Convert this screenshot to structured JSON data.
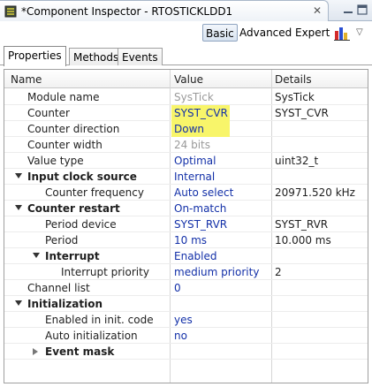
{
  "window": {
    "title": "*Component Inspector - RTOSTICKLDD1",
    "close_glyph": "✕"
  },
  "toolbar": {
    "modes": [
      "Basic",
      "Advanced",
      "Expert"
    ],
    "selected_mode": "Basic",
    "chart_icon": "bar-chart-icon",
    "menu_glyph": "▽"
  },
  "tabs": [
    {
      "label": "Properties",
      "active": true
    },
    {
      "label": "Methods",
      "active": false
    },
    {
      "label": "Events",
      "active": false
    }
  ],
  "table": {
    "headers": {
      "name": "Name",
      "value": "Value",
      "details": "Details"
    },
    "rows": [
      {
        "name": "Module name",
        "value": "SysTick",
        "details": "SysTick",
        "value_gray": true
      },
      {
        "name": "Counter",
        "value": "SYST_CVR",
        "details": "SYST_CVR",
        "highlight": true
      },
      {
        "name": "Counter direction",
        "value": "Down",
        "details": "",
        "highlight": true
      },
      {
        "name": "Counter width",
        "value": "24 bits",
        "details": "",
        "value_gray": true
      },
      {
        "name": "Value type",
        "value": "Optimal",
        "details": "uint32_t"
      },
      {
        "name": "Input clock source",
        "value": "Internal",
        "details": "",
        "bold": true,
        "expander": "open"
      },
      {
        "name": "Counter frequency",
        "value": "Auto select",
        "details": "20971.520 kHz"
      },
      {
        "name": "Counter restart",
        "value": "On-match",
        "details": "",
        "bold": true,
        "expander": "open"
      },
      {
        "name": "Period device",
        "value": "SYST_RVR",
        "details": "SYST_RVR"
      },
      {
        "name": "Period",
        "value": "10 ms",
        "details": "10.000 ms"
      },
      {
        "name": "Interrupt",
        "value": "Enabled",
        "details": "",
        "bold": true,
        "expander": "open"
      },
      {
        "name": "Interrupt priority",
        "value": "medium priority",
        "details": "2"
      },
      {
        "name": "Channel list",
        "value": "0",
        "details": ""
      },
      {
        "name": "Initialization",
        "value": "",
        "details": "",
        "bold": true,
        "expander": "open"
      },
      {
        "name": "Enabled in init. code",
        "value": "yes",
        "details": ""
      },
      {
        "name": "Auto initialization",
        "value": "no",
        "details": ""
      },
      {
        "name": "Event mask",
        "value": "",
        "details": "",
        "bold": true,
        "expander": "closed"
      }
    ]
  },
  "colors": {
    "value_text": "#1330a8",
    "highlight": "#f8f56a",
    "gray_text": "#9a9a9a"
  }
}
